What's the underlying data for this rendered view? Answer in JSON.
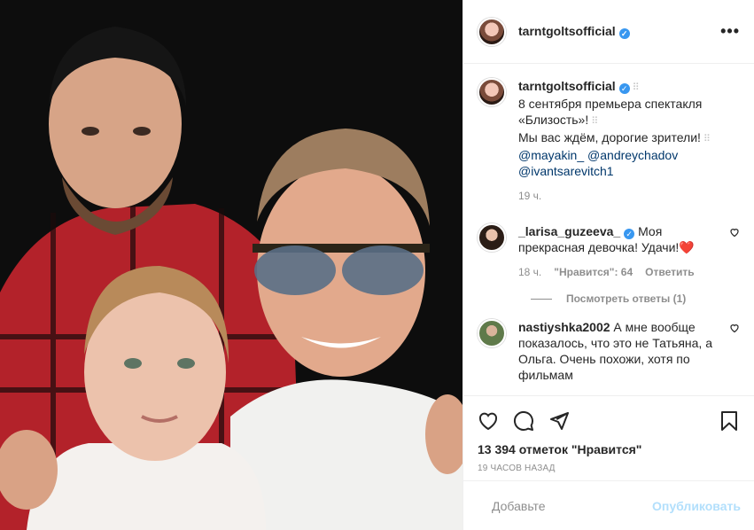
{
  "post": {
    "photo_alt": "",
    "author": {
      "username": "tarntgoltsofficial",
      "verified": true
    },
    "caption": {
      "username": "tarntgoltsofficial",
      "line1": "8 сентября премьера спектакля",
      "line2": "«Близость»!",
      "line3": "Мы вас ждём, дорогие зрители!",
      "mentions_line1": [
        "@mayakin_",
        "@andreychadov"
      ],
      "mentions_line2": [
        "@ivantsarevitch1"
      ],
      "time": "19 ч."
    },
    "comments": [
      {
        "username": "_larisa_guzeeva_",
        "verified": true,
        "text": "Моя прекрасная девочка! Удачи!",
        "time": "18 ч.",
        "likes": "\"Нравится\": 64",
        "reply": "Ответить",
        "view_replies": "Посмотреть ответы (1)"
      },
      {
        "username": "nastiyshka2002",
        "text": "А мне вообще показалось, что это не Татьяна, а Ольга. Очень похожи, хотя по фильмам"
      }
    ],
    "likes_text": "13 394 отметок \"Нравится\"",
    "timestamp": "19 часов назад",
    "add_comment_placeholder": "Добавьте",
    "publish_label": "Опубликовать"
  },
  "icons": {
    "like": "heart-icon",
    "comment": "comment-icon",
    "share": "share-icon",
    "save": "bookmark-icon",
    "emoji": "emoji-icon",
    "more": "more-icon"
  },
  "colors": {
    "link": "#00376b",
    "verified": "#3897f0",
    "muted": "#8e8e8e",
    "publish": "#b2dffc",
    "heart": "#ed4956"
  }
}
